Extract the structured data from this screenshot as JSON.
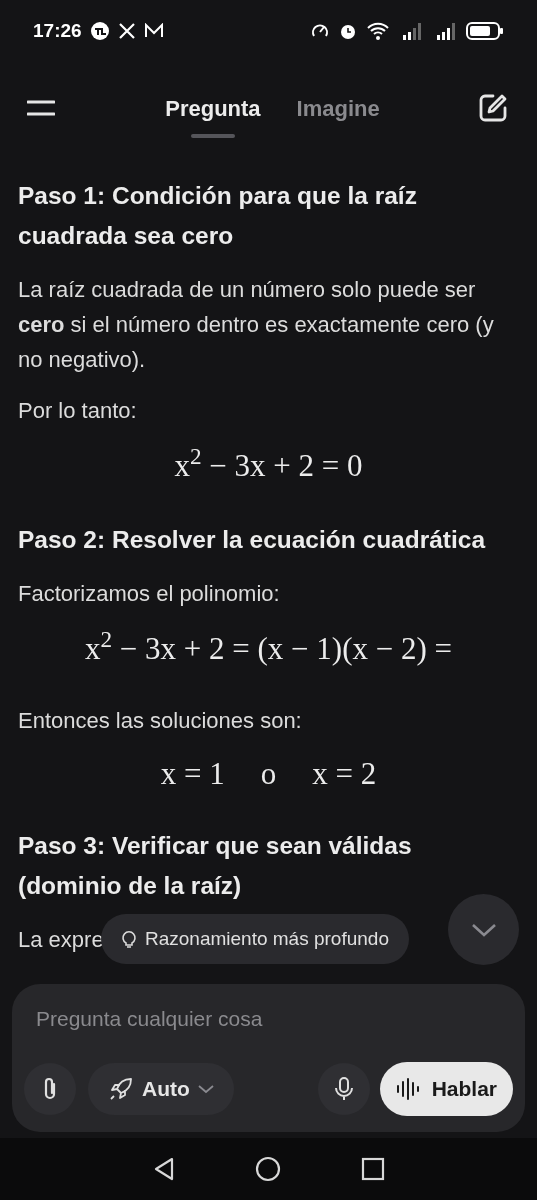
{
  "status_bar": {
    "time": "17:26"
  },
  "tabs": [
    {
      "label": "Pregunta",
      "selected": true
    },
    {
      "label": "Imagine",
      "selected": false
    }
  ],
  "content": [
    {
      "kind": "heading",
      "text": "Paso 1: Condición para que la raíz cuadrada sea cero"
    },
    {
      "kind": "paragraph",
      "text": "La raíz cuadrada de un número solo puede ser **cero** si el número dentro es exactamente cero (y no negativo)."
    },
    {
      "kind": "paragraph",
      "text": "Por lo tanto:"
    },
    {
      "kind": "equation",
      "text": "x$^{2}$ − 3x + 2 = 0"
    },
    {
      "kind": "heading",
      "text": "Paso 2: Resolver la ecuación cuadrática"
    },
    {
      "kind": "paragraph",
      "text": "Factorizamos el polinomio:"
    },
    {
      "kind": "equation",
      "text": "x$^{2}$ − 3x + 2 = (x − 1)(x − 2) ="
    },
    {
      "kind": "paragraph",
      "text": "Entonces las soluciones son:"
    },
    {
      "kind": "solutions",
      "parts": [
        "x = 1",
        "o",
        "x = 2"
      ]
    },
    {
      "kind": "heading",
      "text": "Paso 3: Verificar que sean válidas (dominio de la raíz)"
    },
    {
      "kind": "paragraph",
      "text": "La expre"
    }
  ],
  "reasoning_chip": {
    "label": "Razonamiento más profundo"
  },
  "composer": {
    "placeholder": "Pregunta cualquier cosa",
    "mode": "Auto",
    "speak": "Hablar"
  }
}
